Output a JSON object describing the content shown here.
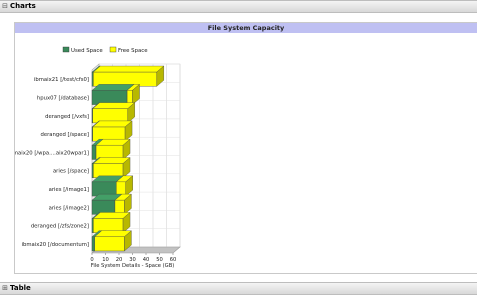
{
  "sections": {
    "charts": {
      "toggle": "⊟",
      "label": "Charts"
    },
    "table": {
      "toggle": "⊞",
      "label": "Table"
    }
  },
  "chart_data": {
    "type": "bar",
    "orientation": "horizontal",
    "stacked": true,
    "title": "File System Capacity",
    "xlabel": "File System Details - Space (GB)",
    "ylabel": "",
    "xlim": [
      0,
      60
    ],
    "xticks": [
      0,
      10,
      20,
      30,
      40,
      50,
      60
    ],
    "grid": true,
    "legend_position": "top",
    "categories": [
      "ibmaix21 [/test/cfs0]",
      "hpux07 [/database]",
      "deranged [/vxfs]",
      "deranged [/space]",
      "ibmaix20 [/wpa....aix20wpar1]",
      "aries [/space]",
      "aries [/image1]",
      "aries [/image2]",
      "deranged [/zfs/zone2]",
      "ibmaix20 [/documentum]"
    ],
    "series": [
      {
        "name": "Used Space",
        "color": "#3a8a5a",
        "values": [
          1,
          26,
          0.5,
          0.5,
          3,
          1,
          18,
          17,
          1,
          2
        ]
      },
      {
        "name": "Free Space",
        "color": "#ffff00",
        "values": [
          47,
          4,
          26,
          24,
          20,
          22,
          7,
          7,
          22,
          22
        ]
      }
    ]
  }
}
